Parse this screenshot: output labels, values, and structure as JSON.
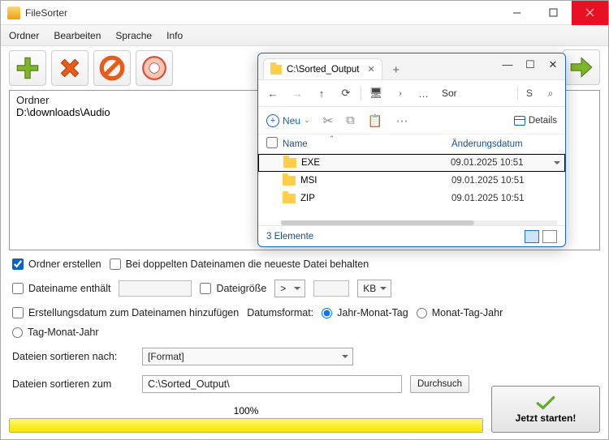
{
  "window": {
    "title": "FileSorter"
  },
  "menu": {
    "folder": "Ordner",
    "edit": "Bearbeiten",
    "lang": "Sprache",
    "info": "Info"
  },
  "folder_area": {
    "header": "Ordner",
    "path": "D:\\downloads\\Audio"
  },
  "options": {
    "create_folder": "Ordner erstellen",
    "keep_newest": "Bei doppelten Dateinamen die neueste Datei behalten",
    "filename_contains": "Dateiname enthält",
    "filesize": "Dateigröße",
    "op": ">",
    "unit": "KB",
    "add_date": "Erstellungsdatum zum Dateinamen hinzufügen",
    "dateformat_label": "Datumsformat:",
    "df1": "Jahr-Monat-Tag",
    "df2": "Monat-Tag-Jahr",
    "df3": "Tag-Monat-Jahr"
  },
  "sort": {
    "by_label": "Dateien sortieren nach:",
    "by_value": "[Format]",
    "to_label": "Dateien sortieren zum",
    "to_path": "C:\\Sorted_Output\\",
    "browse": "Durchsuch"
  },
  "progress": {
    "pct": "100%",
    "value": 100
  },
  "start": {
    "label": "Jetzt starten!"
  },
  "explorer": {
    "tab_title": "C:\\Sorted_Output",
    "crumb": "Sor",
    "new": "Neu",
    "details": "Details",
    "col_name": "Name",
    "col_date": "Änderungsdatum",
    "rows": [
      {
        "name": "EXE",
        "date": "09.01.2025 10:51"
      },
      {
        "name": "MSI",
        "date": "09.01.2025 10:51"
      },
      {
        "name": "ZIP",
        "date": "09.01.2025 10:51"
      }
    ],
    "status": "3 Elemente",
    "search_letter": "S"
  }
}
